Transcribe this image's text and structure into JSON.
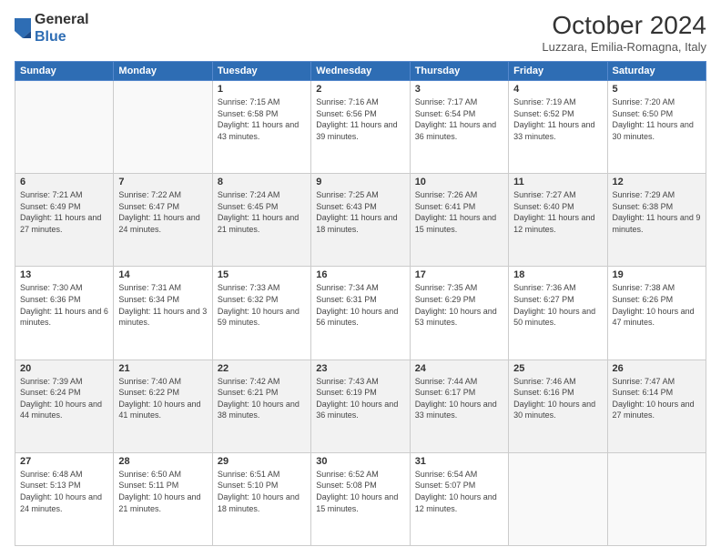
{
  "header": {
    "logo_general": "General",
    "logo_blue": "Blue",
    "month_year": "October 2024",
    "location": "Luzzara, Emilia-Romagna, Italy"
  },
  "weekdays": [
    "Sunday",
    "Monday",
    "Tuesday",
    "Wednesday",
    "Thursday",
    "Friday",
    "Saturday"
  ],
  "weeks": [
    [
      {
        "day": "",
        "sunrise": "",
        "sunset": "",
        "daylight": ""
      },
      {
        "day": "",
        "sunrise": "",
        "sunset": "",
        "daylight": ""
      },
      {
        "day": "1",
        "sunrise": "Sunrise: 7:15 AM",
        "sunset": "Sunset: 6:58 PM",
        "daylight": "Daylight: 11 hours and 43 minutes."
      },
      {
        "day": "2",
        "sunrise": "Sunrise: 7:16 AM",
        "sunset": "Sunset: 6:56 PM",
        "daylight": "Daylight: 11 hours and 39 minutes."
      },
      {
        "day": "3",
        "sunrise": "Sunrise: 7:17 AM",
        "sunset": "Sunset: 6:54 PM",
        "daylight": "Daylight: 11 hours and 36 minutes."
      },
      {
        "day": "4",
        "sunrise": "Sunrise: 7:19 AM",
        "sunset": "Sunset: 6:52 PM",
        "daylight": "Daylight: 11 hours and 33 minutes."
      },
      {
        "day": "5",
        "sunrise": "Sunrise: 7:20 AM",
        "sunset": "Sunset: 6:50 PM",
        "daylight": "Daylight: 11 hours and 30 minutes."
      }
    ],
    [
      {
        "day": "6",
        "sunrise": "Sunrise: 7:21 AM",
        "sunset": "Sunset: 6:49 PM",
        "daylight": "Daylight: 11 hours and 27 minutes."
      },
      {
        "day": "7",
        "sunrise": "Sunrise: 7:22 AM",
        "sunset": "Sunset: 6:47 PM",
        "daylight": "Daylight: 11 hours and 24 minutes."
      },
      {
        "day": "8",
        "sunrise": "Sunrise: 7:24 AM",
        "sunset": "Sunset: 6:45 PM",
        "daylight": "Daylight: 11 hours and 21 minutes."
      },
      {
        "day": "9",
        "sunrise": "Sunrise: 7:25 AM",
        "sunset": "Sunset: 6:43 PM",
        "daylight": "Daylight: 11 hours and 18 minutes."
      },
      {
        "day": "10",
        "sunrise": "Sunrise: 7:26 AM",
        "sunset": "Sunset: 6:41 PM",
        "daylight": "Daylight: 11 hours and 15 minutes."
      },
      {
        "day": "11",
        "sunrise": "Sunrise: 7:27 AM",
        "sunset": "Sunset: 6:40 PM",
        "daylight": "Daylight: 11 hours and 12 minutes."
      },
      {
        "day": "12",
        "sunrise": "Sunrise: 7:29 AM",
        "sunset": "Sunset: 6:38 PM",
        "daylight": "Daylight: 11 hours and 9 minutes."
      }
    ],
    [
      {
        "day": "13",
        "sunrise": "Sunrise: 7:30 AM",
        "sunset": "Sunset: 6:36 PM",
        "daylight": "Daylight: 11 hours and 6 minutes."
      },
      {
        "day": "14",
        "sunrise": "Sunrise: 7:31 AM",
        "sunset": "Sunset: 6:34 PM",
        "daylight": "Daylight: 11 hours and 3 minutes."
      },
      {
        "day": "15",
        "sunrise": "Sunrise: 7:33 AM",
        "sunset": "Sunset: 6:32 PM",
        "daylight": "Daylight: 10 hours and 59 minutes."
      },
      {
        "day": "16",
        "sunrise": "Sunrise: 7:34 AM",
        "sunset": "Sunset: 6:31 PM",
        "daylight": "Daylight: 10 hours and 56 minutes."
      },
      {
        "day": "17",
        "sunrise": "Sunrise: 7:35 AM",
        "sunset": "Sunset: 6:29 PM",
        "daylight": "Daylight: 10 hours and 53 minutes."
      },
      {
        "day": "18",
        "sunrise": "Sunrise: 7:36 AM",
        "sunset": "Sunset: 6:27 PM",
        "daylight": "Daylight: 10 hours and 50 minutes."
      },
      {
        "day": "19",
        "sunrise": "Sunrise: 7:38 AM",
        "sunset": "Sunset: 6:26 PM",
        "daylight": "Daylight: 10 hours and 47 minutes."
      }
    ],
    [
      {
        "day": "20",
        "sunrise": "Sunrise: 7:39 AM",
        "sunset": "Sunset: 6:24 PM",
        "daylight": "Daylight: 10 hours and 44 minutes."
      },
      {
        "day": "21",
        "sunrise": "Sunrise: 7:40 AM",
        "sunset": "Sunset: 6:22 PM",
        "daylight": "Daylight: 10 hours and 41 minutes."
      },
      {
        "day": "22",
        "sunrise": "Sunrise: 7:42 AM",
        "sunset": "Sunset: 6:21 PM",
        "daylight": "Daylight: 10 hours and 38 minutes."
      },
      {
        "day": "23",
        "sunrise": "Sunrise: 7:43 AM",
        "sunset": "Sunset: 6:19 PM",
        "daylight": "Daylight: 10 hours and 36 minutes."
      },
      {
        "day": "24",
        "sunrise": "Sunrise: 7:44 AM",
        "sunset": "Sunset: 6:17 PM",
        "daylight": "Daylight: 10 hours and 33 minutes."
      },
      {
        "day": "25",
        "sunrise": "Sunrise: 7:46 AM",
        "sunset": "Sunset: 6:16 PM",
        "daylight": "Daylight: 10 hours and 30 minutes."
      },
      {
        "day": "26",
        "sunrise": "Sunrise: 7:47 AM",
        "sunset": "Sunset: 6:14 PM",
        "daylight": "Daylight: 10 hours and 27 minutes."
      }
    ],
    [
      {
        "day": "27",
        "sunrise": "Sunrise: 6:48 AM",
        "sunset": "Sunset: 5:13 PM",
        "daylight": "Daylight: 10 hours and 24 minutes."
      },
      {
        "day": "28",
        "sunrise": "Sunrise: 6:50 AM",
        "sunset": "Sunset: 5:11 PM",
        "daylight": "Daylight: 10 hours and 21 minutes."
      },
      {
        "day": "29",
        "sunrise": "Sunrise: 6:51 AM",
        "sunset": "Sunset: 5:10 PM",
        "daylight": "Daylight: 10 hours and 18 minutes."
      },
      {
        "day": "30",
        "sunrise": "Sunrise: 6:52 AM",
        "sunset": "Sunset: 5:08 PM",
        "daylight": "Daylight: 10 hours and 15 minutes."
      },
      {
        "day": "31",
        "sunrise": "Sunrise: 6:54 AM",
        "sunset": "Sunset: 5:07 PM",
        "daylight": "Daylight: 10 hours and 12 minutes."
      },
      {
        "day": "",
        "sunrise": "",
        "sunset": "",
        "daylight": ""
      },
      {
        "day": "",
        "sunrise": "",
        "sunset": "",
        "daylight": ""
      }
    ]
  ]
}
